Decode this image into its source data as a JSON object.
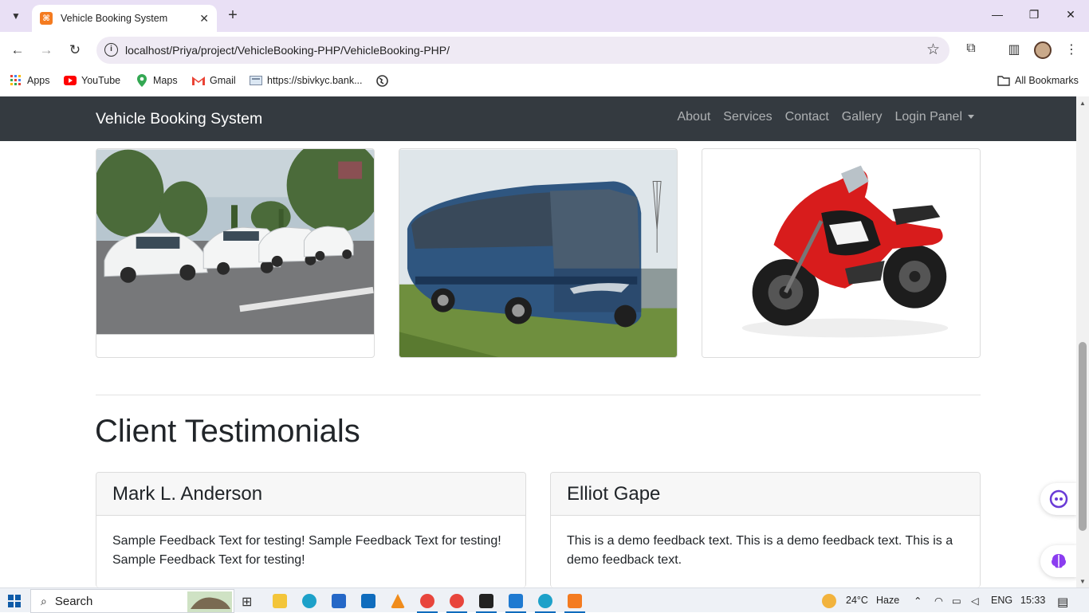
{
  "browser": {
    "tab_title": "Vehicle Booking System",
    "tab_favicon": "xampp-icon",
    "url": "localhost/Priya/project/VehicleBooking-PHP/VehicleBooking-PHP/",
    "bookmarks": [
      {
        "label": "Apps",
        "icon": "apps-grid-icon"
      },
      {
        "label": "YouTube",
        "icon": "youtube-icon"
      },
      {
        "label": "Maps",
        "icon": "maps-pin-icon"
      },
      {
        "label": "Gmail",
        "icon": "gmail-icon"
      },
      {
        "label": "https://sbivkyc.bank...",
        "icon": "page-icon"
      }
    ],
    "all_bookmarks": "All Bookmarks"
  },
  "site": {
    "brand": "Vehicle Booking System",
    "nav": [
      "About",
      "Services",
      "Contact",
      "Gallery",
      "Login Panel"
    ],
    "gallery": [
      {
        "alt": "taxi-cars-photo"
      },
      {
        "alt": "greyhound-bus-photo"
      },
      {
        "alt": "red-motorcycle-photo"
      }
    ],
    "testimonials_title": "Client Testimonials",
    "testimonials": [
      {
        "name": "Mark L. Anderson",
        "text": "Sample Feedback Text for testing! Sample Feedback Text for testing! Sample Feedback Text for testing!"
      },
      {
        "name": "Elliot Gape",
        "text": "This is a demo feedback text. This is a demo feedback text. This is a demo feedback text."
      }
    ]
  },
  "taskbar": {
    "search": "Search",
    "weather": "24°C",
    "weather_desc": "Haze",
    "lang": "ENG",
    "time": "15:33"
  }
}
